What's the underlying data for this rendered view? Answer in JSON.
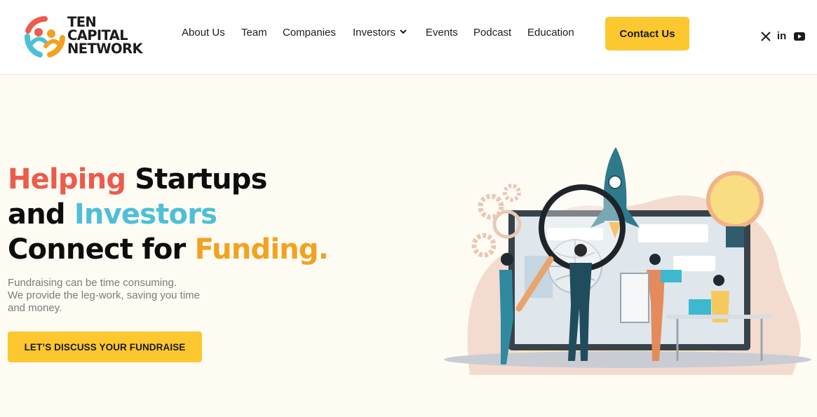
{
  "brand": {
    "logo_lines": [
      "TEN",
      "CAPITAL",
      "NETWORK"
    ],
    "colors": {
      "red": "#ec5b4b",
      "teal": "#4dbfd8",
      "orange": "#f3a11e",
      "yellow": "#fcc72f"
    }
  },
  "nav": {
    "items": [
      {
        "label": "About Us"
      },
      {
        "label": "Team"
      },
      {
        "label": "Companies"
      },
      {
        "label": "Investors",
        "has_dropdown": true
      },
      {
        "label": "Events"
      },
      {
        "label": "Podcast"
      },
      {
        "label": "Education"
      }
    ],
    "contact_label": "Contact Us"
  },
  "social": {
    "icons": [
      "x-icon",
      "linkedin-icon",
      "youtube-icon"
    ],
    "linkedin_text": "in"
  },
  "hero": {
    "title": {
      "line1": {
        "highlight": "Helping",
        "rest": " Startups"
      },
      "line2": {
        "lead": "and ",
        "highlight": "Investors"
      },
      "line3": {
        "lead": "Connect for ",
        "highlight": "Funding."
      }
    },
    "subtitle_lines": [
      "Fundraising can be time consuming.",
      "We provide the leg-work, saving you time",
      "and money."
    ],
    "cta_label": "LET’S DISCUSS YOUR FUNDRAISE"
  }
}
